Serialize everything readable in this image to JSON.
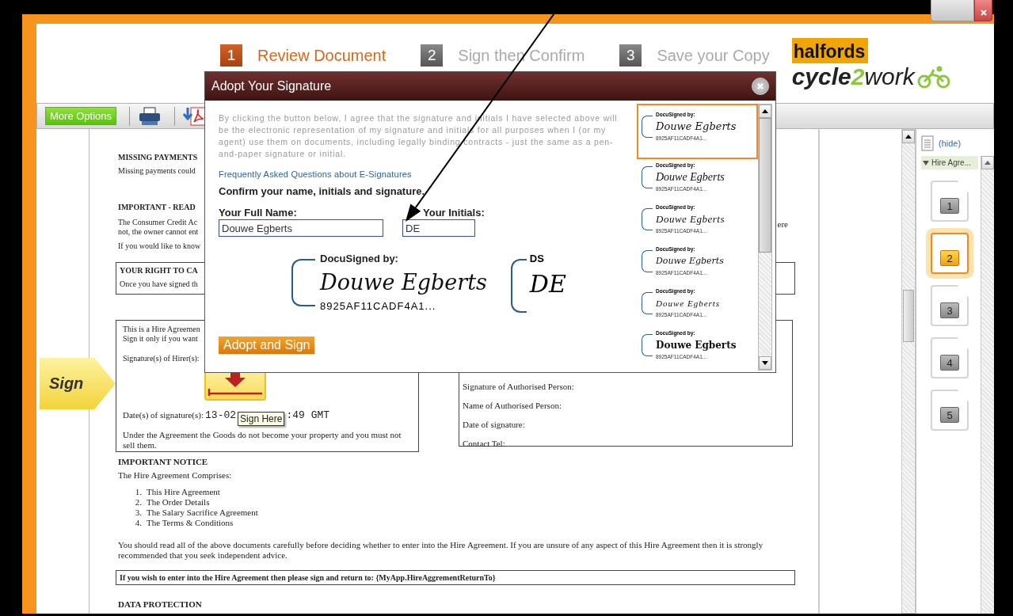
{
  "steps": [
    {
      "number": "1",
      "label": "Review Document",
      "selected": true
    },
    {
      "number": "2",
      "label": "Sign then Confirm",
      "selected": false
    },
    {
      "number": "3",
      "label": "Save your Copy",
      "selected": false
    }
  ],
  "logo": {
    "brand": "halfords",
    "product_parts": [
      "cycle",
      "2",
      "work"
    ]
  },
  "toolbar": {
    "more_options": "More Options"
  },
  "sign_tab": "Sign",
  "document": {
    "missing_payments": {
      "heading": "MISSING PAYMENTS",
      "text": "Missing payments could"
    },
    "important_read": {
      "heading": "IMPORTANT - READ",
      "lines": [
        "The Consumer Credit Ac",
        "not, the owner cannot ent"
      ],
      "line_end": "ere",
      "note": "If you would like to know"
    },
    "right_to_cancel": {
      "heading": "YOUR RIGHT TO CA",
      "text": "Once you have signed th"
    },
    "hirer_box": {
      "lines": [
        "This is a Hire Agreemen",
        "Sign it only if you want"
      ],
      "signature_label": "Signature(s) of Hirer(s):",
      "date_label": "Date(s) of signature(s):",
      "date_start": "13-02",
      "date_end": ":49 GMT",
      "note": "Under the Agreement the Goods do not become your property and you must not sell them."
    },
    "owner_box": {
      "fields": [
        "Signature of Authorised Person:",
        "Name of Authorised Person:",
        "Date of signature:",
        "Contact Tel:"
      ]
    },
    "notice": {
      "heading": "IMPORTANT NOTICE",
      "intro": "The Hire Agreement Comprises:",
      "items": [
        {
          "number": "1.",
          "text": "This Hire Agreement"
        },
        {
          "number": "2.",
          "text": "The Order Details"
        },
        {
          "number": "3.",
          "text": "The Salary Sacrifice Agreement"
        },
        {
          "number": "4.",
          "text": "The Terms & Conditions"
        }
      ],
      "advice": "You should read all of the above documents carefully before deciding whether to enter into the Hire Agreement. If you are unsure of any aspect of this Hire Agreement then it is strongly recommended that you seek independent advice.",
      "return_note": "If you wish to enter into the Hire Agreement then please sign and return to: {MyApp.HireAggrementReturnTo}"
    },
    "data_protection": "DATA PROTECTION"
  },
  "tooltip": "Sign Here",
  "dialog": {
    "title": "Adopt Your Signature",
    "consent": "By clicking the button below, I agree that the signature and initials I have selected above will be the electronic representation of my signature and initials for all purposes when I (or my agent) use them on documents, including legally binding contracts - just the same as a pen-and-paper signature or initial.",
    "faq_link": "Frequently Asked Questions about E-Signatures",
    "confirm": "Confirm your name, initials and signature.",
    "name_label": "Your Full Name:",
    "name_value": "Douwe Egberts",
    "initials_label": "Your Initials:",
    "initials_value": "DE",
    "preview": {
      "caption": "DocuSigned by:",
      "signature": "Douwe Egberts",
      "id": "8925AF11CADF4A1..."
    },
    "initials_preview": {
      "caption": "DS",
      "initials": "DE"
    },
    "adopt_button": "Adopt and Sign",
    "styles": [
      {
        "caption": "DocuSigned by:",
        "signature": "Douwe Egberts",
        "id": "8925AF11CADF4A1...",
        "selected": true
      },
      {
        "caption": "DocuSigned by:",
        "signature": "Douwe Egberts",
        "id": "8925AF11CADF4A1...",
        "selected": false
      },
      {
        "caption": "DocuSigned by:",
        "signature": "Douwe Egberts",
        "id": "8925AF11CADF4A1...",
        "selected": false
      },
      {
        "caption": "DocuSigned by:",
        "signature": "Douwe Egberts",
        "id": "8925AF11CADF4A1...",
        "selected": false
      },
      {
        "caption": "DocuSigned by:",
        "signature": "Douwe Egberts",
        "id": "8925AF11CADF4A1...",
        "selected": false
      },
      {
        "caption": "DocuSigned by:",
        "signature": "Douwe Egberts",
        "id": "8925AF11CADF4A1...",
        "selected": false
      }
    ]
  },
  "thumbnails": {
    "hide": "(hide)",
    "section": "Hire Agre...",
    "expanded": true,
    "pages": [
      {
        "number": "1",
        "selected": false
      },
      {
        "number": "2",
        "selected": true
      },
      {
        "number": "3",
        "selected": false
      },
      {
        "number": "4",
        "selected": false
      },
      {
        "number": "5",
        "selected": false
      }
    ]
  }
}
